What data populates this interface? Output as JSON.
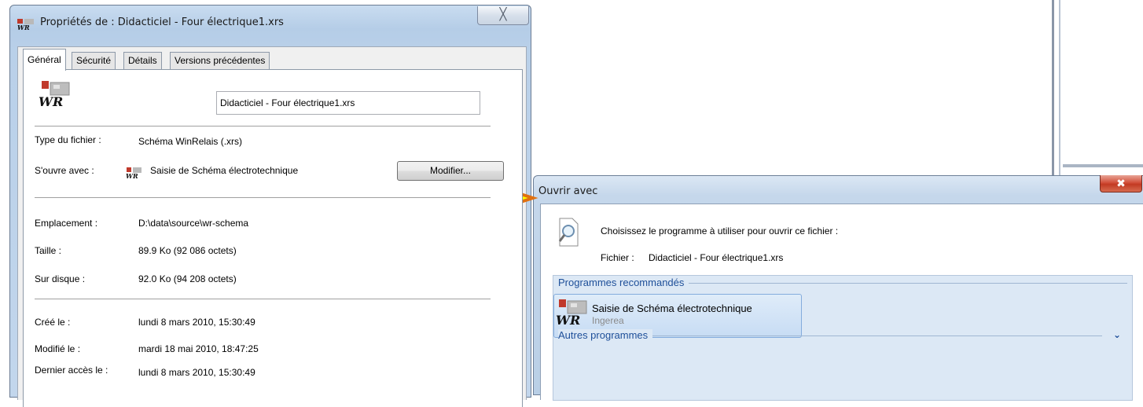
{
  "properties_window": {
    "title": "Propriétés de : Didacticiel - Four électrique1.xrs",
    "close_glyph": "╳",
    "tabs": [
      {
        "label": "Général",
        "active": true
      },
      {
        "label": "Sécurité",
        "active": false
      },
      {
        "label": "Détails",
        "active": false
      },
      {
        "label": "Versions précédentes",
        "active": false
      }
    ],
    "filename": "Didacticiel - Four électrique1.xrs",
    "file_type": {
      "label": "Type du fichier :",
      "value": "Schéma WinRelais (.xrs)"
    },
    "opens_with": {
      "label": "S'ouvre avec :",
      "value": "Saisie de Schéma électrotechnique",
      "button": "Modifier..."
    },
    "location": {
      "label": "Emplacement :",
      "value": "D:\\data\\source\\wr-schema"
    },
    "size": {
      "label": "Taille :",
      "value": "89.9 Ko (92 086 octets)"
    },
    "size_on_disk": {
      "label": "Sur disque :",
      "value": "92.0 Ko (94 208 octets)"
    },
    "created": {
      "label": "Créé le :",
      "value": "lundi 8 mars 2010, 15:30:49"
    },
    "modified": {
      "label": "Modifié le :",
      "value": "mardi 18 mai 2010, 18:47:25"
    },
    "accessed": {
      "label": "Dernier accès le :",
      "value": "lundi 8 mars 2010, 15:30:49"
    }
  },
  "open_with_dialog": {
    "title": "Ouvrir avec",
    "close_glyph": "✖",
    "prompt": "Choisissez le programme à utiliser pour ouvrir ce fichier :",
    "file_label": "Fichier :",
    "file_value": "Didacticiel - Four électrique1.xrs",
    "recommended_title": "Programmes recommandés",
    "recommended_apps": [
      {
        "name": "Saisie de Schéma électrotechnique",
        "publisher": "Ingerea"
      }
    ],
    "other_title": "Autres programmes",
    "expand_glyph": "⌄"
  },
  "app_icon_text": "WR",
  "colors": {
    "arrow_fill": "#ffff00",
    "arrow_stroke": "#e07010",
    "section_title": "#1e4f99"
  }
}
